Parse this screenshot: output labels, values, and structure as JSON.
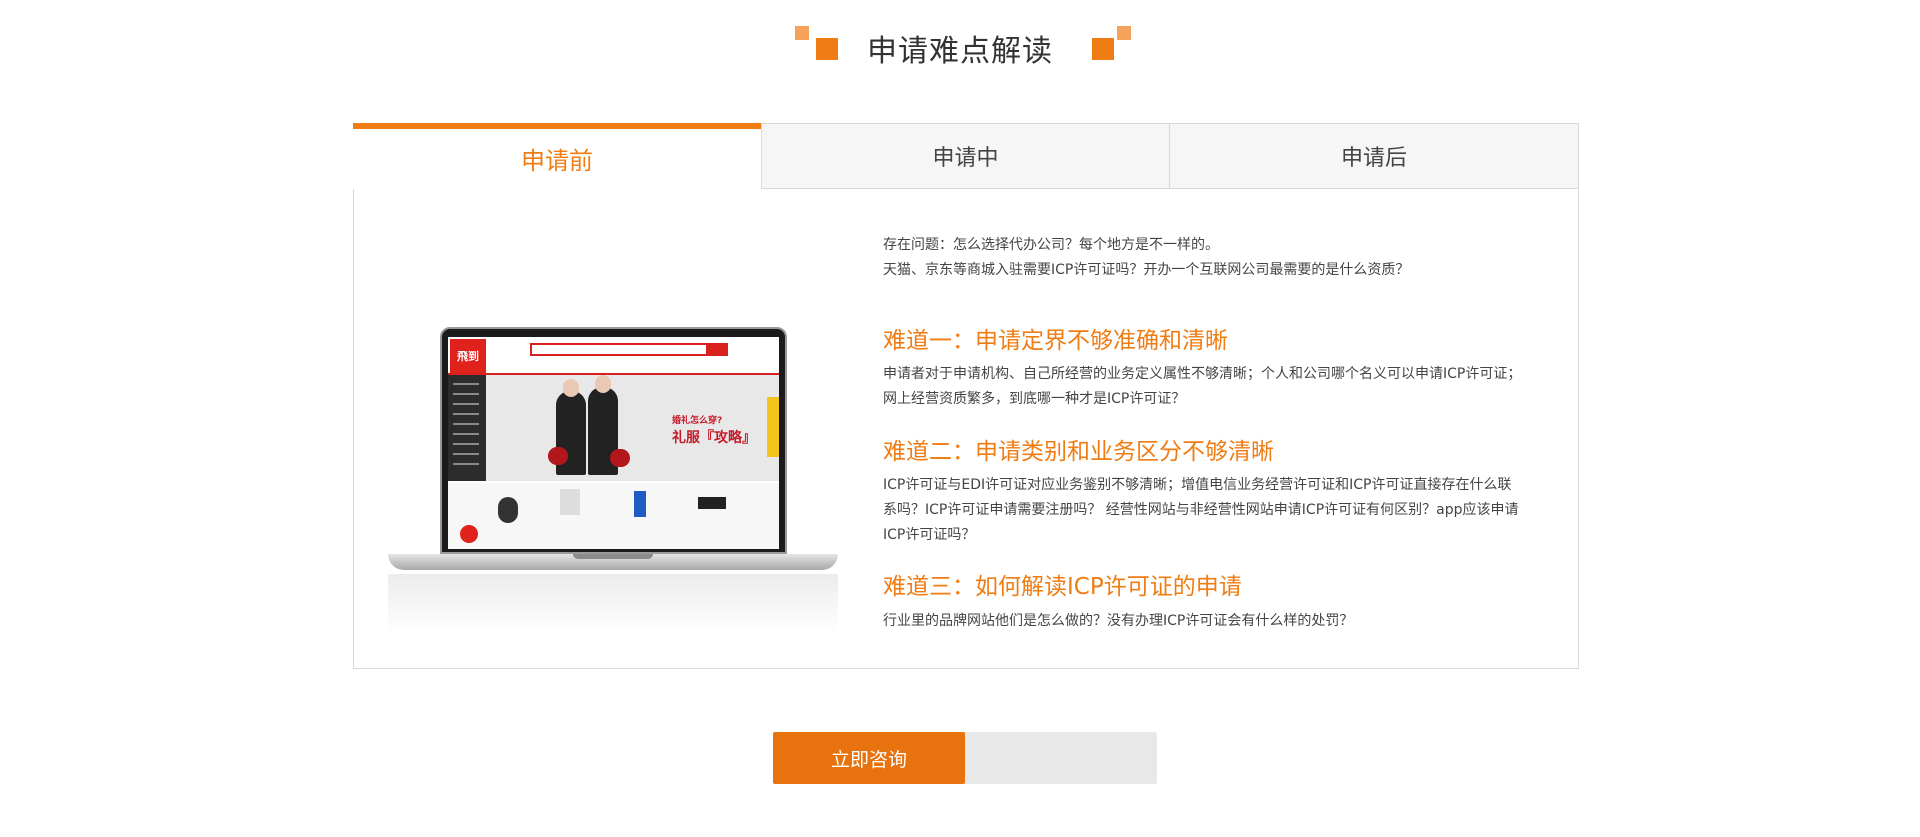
{
  "section": {
    "title": "申请难点解读"
  },
  "tabs": [
    {
      "label": "申请前",
      "active": true
    },
    {
      "label": "申请中",
      "active": false
    },
    {
      "label": "申请后",
      "active": false
    }
  ],
  "content": {
    "problem_lines": [
      "存在问题：怎么选择代办公司？每个地方是不一样的。",
      "天猫、京东等商城入驻需要ICP许可证吗？开办一个互联网公司最需要的是什么资质？"
    ],
    "difficulties": [
      {
        "heading": "难道一：申请定界不够准确和清晰",
        "body": "申请者对于申请机构、自己所经营的业务定义属性不够清晰；个人和公司哪个名义可以申请ICP许可证；网上经营资质繁多，到底哪一种才是ICP许可证？"
      },
      {
        "heading": "难道二：申请类别和业务区分不够清晰",
        "body": "ICP许可证与EDI许可证对应业务鉴别不够清晰；增值电信业务经营许可证和ICP许可证直接存在什么联系吗？ICP许可证申请需要注册吗？ 经营性网站与非经营性网站申请ICP许可证有何区别？app应该申请ICP许可证吗？"
      },
      {
        "heading": "难道三：如何解读ICP许可证的申请",
        "body": "行业里的品牌网站他们是怎么做的？没有办理ICP许可证会有什么样的处罚？"
      }
    ]
  },
  "illustration": {
    "logo_text": "飛到",
    "banner_line1": "婚礼怎么穿?",
    "banner_line2": "礼服『攻略』"
  },
  "cta": {
    "label": "立即咨询"
  },
  "colors": {
    "accent": "#f07c14",
    "accent_light": "#f5a25a",
    "button": "#e7720e"
  }
}
